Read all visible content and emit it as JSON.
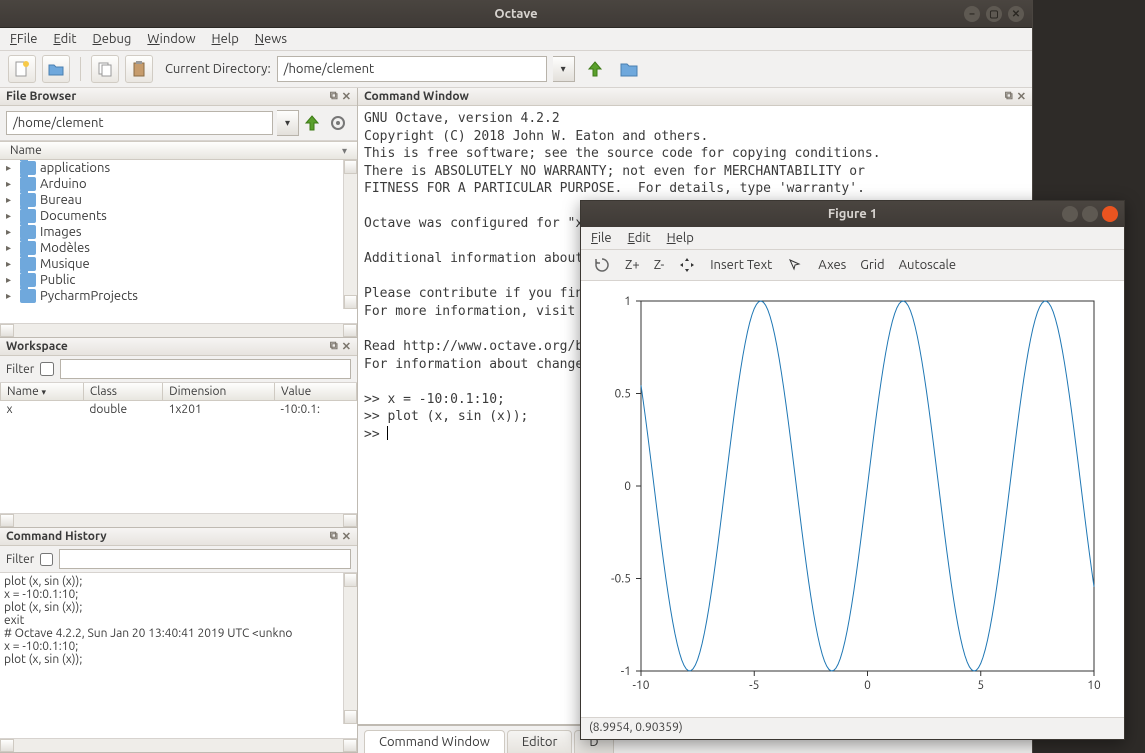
{
  "window": {
    "title": "Octave"
  },
  "menubar": {
    "items": [
      "File",
      "Edit",
      "Debug",
      "Window",
      "Help",
      "News"
    ]
  },
  "toolbar": {
    "curdir_label": "Current Directory:",
    "curdir_value": "/home/clement"
  },
  "file_browser": {
    "title": "File Browser",
    "path": "/home/clement",
    "column": "Name",
    "items": [
      "applications",
      "Arduino",
      "Bureau",
      "Documents",
      "Images",
      "Modèles",
      "Musique",
      "Public",
      "PycharmProjects"
    ]
  },
  "workspace": {
    "title": "Workspace",
    "filter_label": "Filter",
    "columns": [
      "Name",
      "Class",
      "Dimension",
      "Value"
    ],
    "rows": [
      {
        "name": "x",
        "class": "double",
        "dimension": "1x201",
        "value": "-10:0.1:"
      }
    ]
  },
  "command_history": {
    "title": "Command History",
    "filter_label": "Filter",
    "items": [
      "plot (x, sin (x));",
      "x = -10:0.1:10;",
      "plot (x, sin (x));",
      "exit",
      "# Octave 4.2.2, Sun Jan 20 13:40:41 2019 UTC <unkno",
      "x = -10:0.1:10;",
      "plot (x, sin (x));"
    ]
  },
  "command_window": {
    "title": "Command Window",
    "text": "GNU Octave, version 4.2.2\nCopyright (C) 2018 John W. Eaton and others.\nThis is free software; see the source code for copying conditions.\nThere is ABSOLUTELY NO WARRANTY; not even for MERCHANTABILITY or\nFITNESS FOR A PARTICULAR PURPOSE.  For details, type 'warranty'.\n\nOctave was configured for \"x\n\nAdditional information about\n\nPlease contribute if you fin\nFor more information, visit \n\nRead http://www.octave.org/b\nFor information about change\n\n>> x = -10:0.1:10;\n>> plot (x, sin (x));\n>> "
  },
  "bottom_tabs": {
    "items": [
      "Command Window",
      "Editor",
      "D"
    ],
    "active": 0
  },
  "figure": {
    "title": "Figure 1",
    "menubar": [
      "File",
      "Edit",
      "Help"
    ],
    "toolbar": [
      "Z+",
      "Z-",
      "Insert Text",
      "Axes",
      "Grid",
      "Autoscale"
    ],
    "status": "(8.9954, 0.90359)"
  },
  "chart_data": {
    "type": "line",
    "x_range": [
      -10,
      10
    ],
    "x_step": 0.1,
    "function": "sin(x)",
    "xlim": [
      -10,
      10
    ],
    "ylim": [
      -1,
      1
    ],
    "xticks": [
      -10,
      -5,
      0,
      5,
      10
    ],
    "yticks": [
      -1,
      -0.5,
      0,
      0.5,
      1
    ],
    "title": "",
    "xlabel": "",
    "ylabel": "",
    "line_color": "#1f77b4"
  }
}
